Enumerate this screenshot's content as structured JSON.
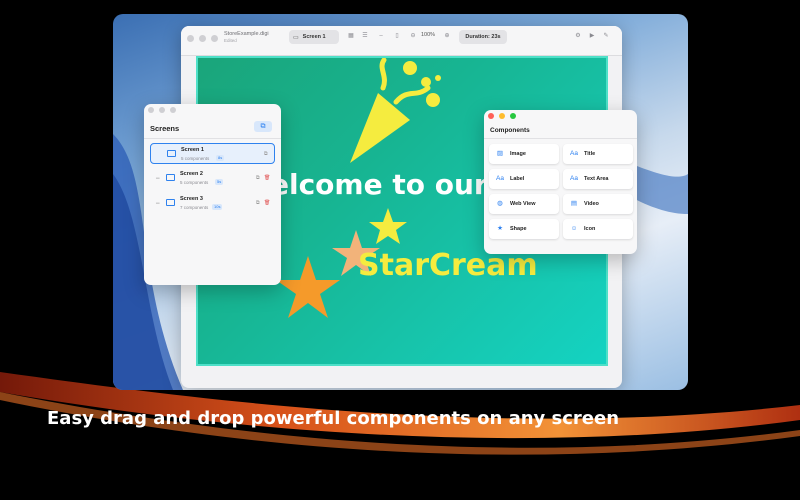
{
  "caption": "Easy drag and drop powerful components on any screen",
  "app": {
    "doc_title": "StoreExample.digi",
    "doc_subtitle": "Edited",
    "screen_selector": "Screen 1",
    "zoom": "100%",
    "duration": "Duration: 23s"
  },
  "canvas": {
    "welcome": "elcome to our",
    "brand": "StarCream"
  },
  "screens_panel": {
    "title": "Screens",
    "rows": [
      {
        "name": "Screen 1",
        "count": "5 components",
        "duration": "8s"
      },
      {
        "name": "Screen 2",
        "count": "5 components",
        "duration": "5s"
      },
      {
        "name": "Screen 3",
        "count": "7 components",
        "duration": "10s"
      }
    ]
  },
  "components_panel": {
    "title": "Components",
    "items": [
      {
        "label": "Image",
        "icon": "image-icon"
      },
      {
        "label": "Title",
        "icon": "title-icon"
      },
      {
        "label": "Label",
        "icon": "label-icon"
      },
      {
        "label": "Text Area",
        "icon": "text-area-icon"
      },
      {
        "label": "Web View",
        "icon": "globe-icon"
      },
      {
        "label": "Video",
        "icon": "film-icon"
      },
      {
        "label": "Shape",
        "icon": "star-icon"
      },
      {
        "label": "Icon",
        "icon": "smiley-icon"
      }
    ]
  },
  "colors": {
    "accent": "#2f82ee",
    "canvas_start": "#1aa57a",
    "canvas_end": "#14d3c2",
    "brand_yellow": "#f5ec3f",
    "star_orange": "#f59a2a"
  }
}
